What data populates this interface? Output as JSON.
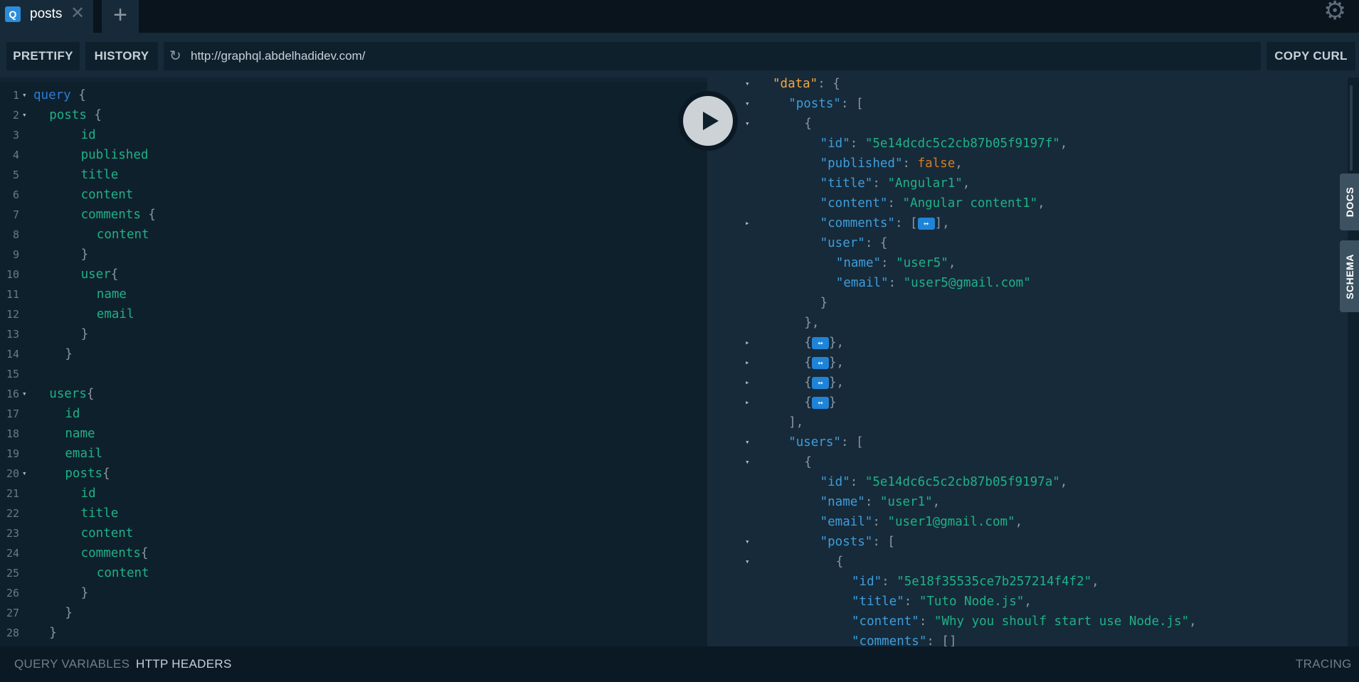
{
  "tab": {
    "badge": "Q",
    "title": "posts",
    "close": "✕",
    "add": "+"
  },
  "toolbar": {
    "prettify": "PRETTIFY",
    "history": "HISTORY",
    "url": "http://graphql.abdelhadidev.com/",
    "copy_curl": "COPY CURL"
  },
  "editor": {
    "lines": [
      {
        "n": "1",
        "fold": true,
        "indent": 0,
        "parts": [
          [
            "kw",
            "query"
          ],
          [
            "pn",
            " {"
          ]
        ]
      },
      {
        "n": "2",
        "fold": true,
        "indent": 2,
        "parts": [
          [
            "fld",
            "posts"
          ],
          [
            "pn",
            " {"
          ]
        ]
      },
      {
        "n": "3",
        "fold": false,
        "indent": 6,
        "parts": [
          [
            "fld",
            "id"
          ]
        ]
      },
      {
        "n": "4",
        "fold": false,
        "indent": 6,
        "parts": [
          [
            "fld",
            "published"
          ]
        ]
      },
      {
        "n": "5",
        "fold": false,
        "indent": 6,
        "parts": [
          [
            "fld",
            "title"
          ]
        ]
      },
      {
        "n": "6",
        "fold": false,
        "indent": 6,
        "parts": [
          [
            "fld",
            "content"
          ]
        ]
      },
      {
        "n": "7",
        "fold": false,
        "indent": 6,
        "parts": [
          [
            "fld",
            "comments"
          ],
          [
            "pn",
            " {"
          ]
        ]
      },
      {
        "n": "8",
        "fold": false,
        "indent": 8,
        "parts": [
          [
            "fld",
            "content"
          ]
        ]
      },
      {
        "n": "9",
        "fold": false,
        "indent": 6,
        "parts": [
          [
            "pn",
            "}"
          ]
        ]
      },
      {
        "n": "10",
        "fold": false,
        "indent": 6,
        "parts": [
          [
            "fld",
            "user"
          ],
          [
            "pn",
            "{"
          ]
        ]
      },
      {
        "n": "11",
        "fold": false,
        "indent": 8,
        "parts": [
          [
            "fld",
            "name"
          ]
        ]
      },
      {
        "n": "12",
        "fold": false,
        "indent": 8,
        "parts": [
          [
            "fld",
            "email"
          ]
        ]
      },
      {
        "n": "13",
        "fold": false,
        "indent": 6,
        "parts": [
          [
            "pn",
            "}"
          ]
        ]
      },
      {
        "n": "14",
        "fold": false,
        "indent": 4,
        "parts": [
          [
            "pn",
            "}"
          ]
        ]
      },
      {
        "n": "15",
        "fold": false,
        "indent": 0,
        "parts": []
      },
      {
        "n": "16",
        "fold": true,
        "indent": 2,
        "parts": [
          [
            "fld",
            "users"
          ],
          [
            "pn",
            "{"
          ]
        ]
      },
      {
        "n": "17",
        "fold": false,
        "indent": 4,
        "parts": [
          [
            "fld",
            "id"
          ]
        ]
      },
      {
        "n": "18",
        "fold": false,
        "indent": 4,
        "parts": [
          [
            "fld",
            "name"
          ]
        ]
      },
      {
        "n": "19",
        "fold": false,
        "indent": 4,
        "parts": [
          [
            "fld",
            "email"
          ]
        ]
      },
      {
        "n": "20",
        "fold": true,
        "indent": 4,
        "parts": [
          [
            "fld",
            "posts"
          ],
          [
            "pn",
            "{"
          ]
        ]
      },
      {
        "n": "21",
        "fold": false,
        "indent": 6,
        "parts": [
          [
            "fld",
            "id"
          ]
        ]
      },
      {
        "n": "22",
        "fold": false,
        "indent": 6,
        "parts": [
          [
            "fld",
            "title"
          ]
        ]
      },
      {
        "n": "23",
        "fold": false,
        "indent": 6,
        "parts": [
          [
            "fld",
            "content"
          ]
        ]
      },
      {
        "n": "24",
        "fold": false,
        "indent": 6,
        "parts": [
          [
            "fld",
            "comments"
          ],
          [
            "pn",
            "{"
          ]
        ]
      },
      {
        "n": "25",
        "fold": false,
        "indent": 8,
        "parts": [
          [
            "fld",
            "content"
          ]
        ]
      },
      {
        "n": "26",
        "fold": false,
        "indent": 6,
        "parts": [
          [
            "pn",
            "}"
          ]
        ]
      },
      {
        "n": "27",
        "fold": false,
        "indent": 4,
        "parts": [
          [
            "pn",
            "}"
          ]
        ]
      },
      {
        "n": "28",
        "fold": false,
        "indent": 2,
        "parts": [
          [
            "pn",
            "}"
          ]
        ]
      }
    ]
  },
  "results": {
    "lines": [
      {
        "fold": "open",
        "indent": 0,
        "parts": [
          [
            "ro",
            "\"data\""
          ],
          [
            "rp",
            ": {"
          ]
        ]
      },
      {
        "fold": "open",
        "indent": 2,
        "parts": [
          [
            "rk",
            "\"posts\""
          ],
          [
            "rp",
            ": ["
          ]
        ]
      },
      {
        "fold": "open",
        "indent": 4,
        "parts": [
          [
            "rp",
            "{"
          ]
        ]
      },
      {
        "fold": "",
        "indent": 6,
        "parts": [
          [
            "rk",
            "\"id\""
          ],
          [
            "rp",
            ": "
          ],
          [
            "rs",
            "\"5e14dcdc5c2cb87b05f9197f\""
          ],
          [
            "rp",
            ","
          ]
        ]
      },
      {
        "fold": "",
        "indent": 6,
        "parts": [
          [
            "rk",
            "\"published\""
          ],
          [
            "rp",
            ": "
          ],
          [
            "rb",
            "false"
          ],
          [
            "rp",
            ","
          ]
        ]
      },
      {
        "fold": "",
        "indent": 6,
        "parts": [
          [
            "rk",
            "\"title\""
          ],
          [
            "rp",
            ": "
          ],
          [
            "rs",
            "\"Angular1\""
          ],
          [
            "rp",
            ","
          ]
        ]
      },
      {
        "fold": "",
        "indent": 6,
        "parts": [
          [
            "rk",
            "\"content\""
          ],
          [
            "rp",
            ": "
          ],
          [
            "rs",
            "\"Angular content1\""
          ],
          [
            "rp",
            ","
          ]
        ]
      },
      {
        "fold": "closed",
        "indent": 6,
        "parts": [
          [
            "rk",
            "\"comments\""
          ],
          [
            "rp",
            ": ["
          ],
          [
            "pill",
            "↔"
          ],
          [
            "rp",
            "],"
          ]
        ]
      },
      {
        "fold": "",
        "indent": 6,
        "parts": [
          [
            "rk",
            "\"user\""
          ],
          [
            "rp",
            ": {"
          ]
        ]
      },
      {
        "fold": "",
        "indent": 8,
        "parts": [
          [
            "rk",
            "\"name\""
          ],
          [
            "rp",
            ": "
          ],
          [
            "rs",
            "\"user5\""
          ],
          [
            "rp",
            ","
          ]
        ]
      },
      {
        "fold": "",
        "indent": 8,
        "parts": [
          [
            "rk",
            "\"email\""
          ],
          [
            "rp",
            ": "
          ],
          [
            "rs",
            "\"user5@gmail.com\""
          ]
        ]
      },
      {
        "fold": "",
        "indent": 6,
        "parts": [
          [
            "rp",
            "}"
          ]
        ]
      },
      {
        "fold": "",
        "indent": 4,
        "parts": [
          [
            "rp",
            "},"
          ]
        ]
      },
      {
        "fold": "closed",
        "indent": 4,
        "parts": [
          [
            "rp",
            "{"
          ],
          [
            "pill",
            "↔"
          ],
          [
            "rp",
            "},"
          ]
        ]
      },
      {
        "fold": "closed",
        "indent": 4,
        "parts": [
          [
            "rp",
            "{"
          ],
          [
            "pill",
            "↔"
          ],
          [
            "rp",
            "},"
          ]
        ]
      },
      {
        "fold": "closed",
        "indent": 4,
        "parts": [
          [
            "rp",
            "{"
          ],
          [
            "pill",
            "↔"
          ],
          [
            "rp",
            "},"
          ]
        ]
      },
      {
        "fold": "closed",
        "indent": 4,
        "parts": [
          [
            "rp",
            "{"
          ],
          [
            "pill",
            "↔"
          ],
          [
            "rp",
            "}"
          ]
        ]
      },
      {
        "fold": "",
        "indent": 2,
        "parts": [
          [
            "rp",
            "],"
          ]
        ]
      },
      {
        "fold": "open",
        "indent": 2,
        "parts": [
          [
            "rk",
            "\"users\""
          ],
          [
            "rp",
            ": ["
          ]
        ]
      },
      {
        "fold": "open",
        "indent": 4,
        "parts": [
          [
            "rp",
            "{"
          ]
        ]
      },
      {
        "fold": "",
        "indent": 6,
        "parts": [
          [
            "rk",
            "\"id\""
          ],
          [
            "rp",
            ": "
          ],
          [
            "rs",
            "\"5e14dc6c5c2cb87b05f9197a\""
          ],
          [
            "rp",
            ","
          ]
        ]
      },
      {
        "fold": "",
        "indent": 6,
        "parts": [
          [
            "rk",
            "\"name\""
          ],
          [
            "rp",
            ": "
          ],
          [
            "rs",
            "\"user1\""
          ],
          [
            "rp",
            ","
          ]
        ]
      },
      {
        "fold": "",
        "indent": 6,
        "parts": [
          [
            "rk",
            "\"email\""
          ],
          [
            "rp",
            ": "
          ],
          [
            "rs",
            "\"user1@gmail.com\""
          ],
          [
            "rp",
            ","
          ]
        ]
      },
      {
        "fold": "open",
        "indent": 6,
        "parts": [
          [
            "rk",
            "\"posts\""
          ],
          [
            "rp",
            ": ["
          ]
        ]
      },
      {
        "fold": "open",
        "indent": 8,
        "parts": [
          [
            "rp",
            "{"
          ]
        ]
      },
      {
        "fold": "",
        "indent": 10,
        "parts": [
          [
            "rk",
            "\"id\""
          ],
          [
            "rp",
            ": "
          ],
          [
            "rs",
            "\"5e18f35535ce7b257214f4f2\""
          ],
          [
            "rp",
            ","
          ]
        ]
      },
      {
        "fold": "",
        "indent": 10,
        "parts": [
          [
            "rk",
            "\"title\""
          ],
          [
            "rp",
            ": "
          ],
          [
            "rs",
            "\"Tuto Node.js\""
          ],
          [
            "rp",
            ","
          ]
        ]
      },
      {
        "fold": "",
        "indent": 10,
        "parts": [
          [
            "rk",
            "\"content\""
          ],
          [
            "rp",
            ": "
          ],
          [
            "rs",
            "\"Why you shoulf start use Node.js\""
          ],
          [
            "rp",
            ","
          ]
        ]
      },
      {
        "fold": "",
        "indent": 10,
        "parts": [
          [
            "rk",
            "\"comments\""
          ],
          [
            "rp",
            ": []"
          ]
        ]
      }
    ]
  },
  "side_tabs": {
    "docs": "DOCS",
    "schema": "SCHEMA"
  },
  "bottom": {
    "query_variables": "QUERY VARIABLES",
    "http_headers": "HTTP HEADERS",
    "tracing": "TRACING"
  },
  "colors": {
    "accent": "#2d8cd9",
    "string": "#1fb186",
    "key": "#3e9ddb",
    "boolean": "#d87c1e",
    "keyword": "#2a7ed2"
  }
}
